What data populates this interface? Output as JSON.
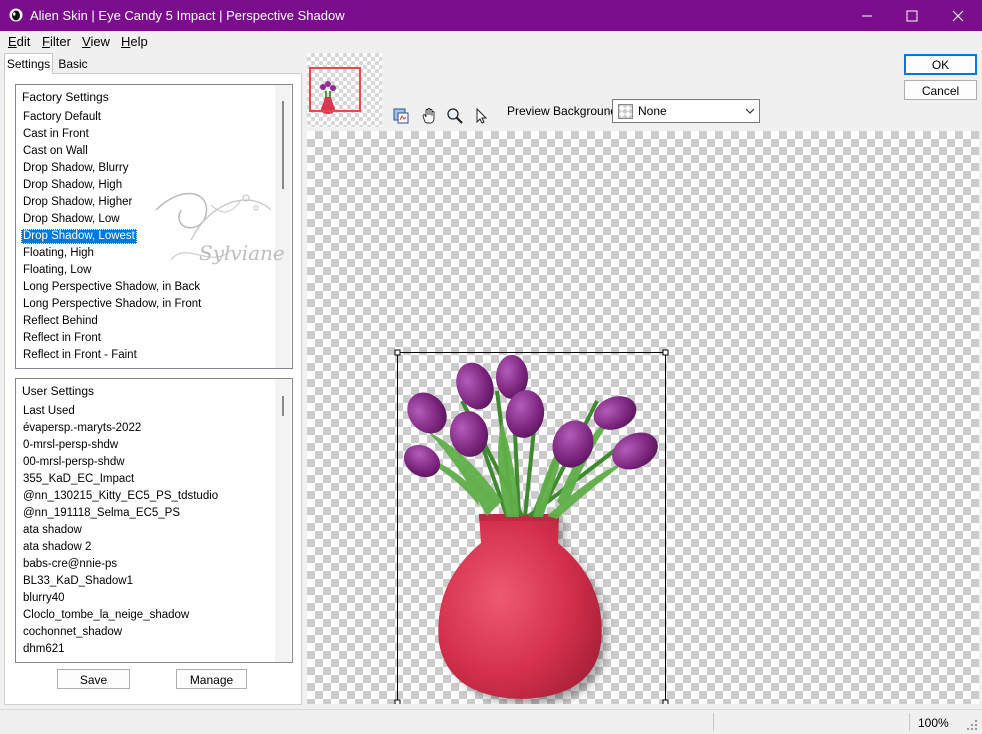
{
  "window": {
    "title": "Alien Skin | Eye Candy 5 Impact | Perspective Shadow",
    "accent_color": "#7a0d8c"
  },
  "menu": [
    {
      "accel": "E",
      "rest": "dit"
    },
    {
      "accel": "F",
      "rest": "ilter"
    },
    {
      "accel": "V",
      "rest": "iew"
    },
    {
      "accel": "H",
      "rest": "elp"
    }
  ],
  "tabs": {
    "settings": "Settings",
    "basic": "Basic"
  },
  "factory": {
    "title": "Factory Settings",
    "items": [
      "Factory Default",
      "Cast in Front",
      "Cast on Wall",
      "Drop Shadow, Blurry",
      "Drop Shadow, High",
      "Drop Shadow, Higher",
      "Drop Shadow, Low",
      "Drop Shadow, Lowest",
      "Floating, High",
      "Floating, Low",
      "Long Perspective Shadow, in Back",
      "Long Perspective Shadow, in Front",
      "Reflect Behind",
      "Reflect in Front",
      "Reflect in Front - Faint"
    ],
    "selected_index": 7
  },
  "user": {
    "title": "User Settings",
    "items": [
      "Last Used",
      "évapersp.-maryts-2022",
      "0-mrsl-persp-shdw",
      "00-mrsl-persp-shdw",
      "355_KaD_EC_Impact",
      "@nn_130215_Kitty_EC5_PS_tdstudio",
      "@nn_191118_Selma_EC5_PS",
      "ata shadow",
      "ata shadow 2",
      "babs-cre@nnie-ps",
      "BL33_KaD_Shadow1",
      "blurry40",
      "Cloclo_tombe_la_neige_shadow",
      "cochonnet_shadow",
      "dhm621"
    ]
  },
  "buttons": {
    "save": "Save",
    "manage": "Manage",
    "ok": "OK",
    "cancel": "Cancel"
  },
  "watermark": "Sylviane",
  "preview": {
    "background_label": "Preview Background:",
    "background_value": "None"
  },
  "status": {
    "zoom": "100%"
  }
}
